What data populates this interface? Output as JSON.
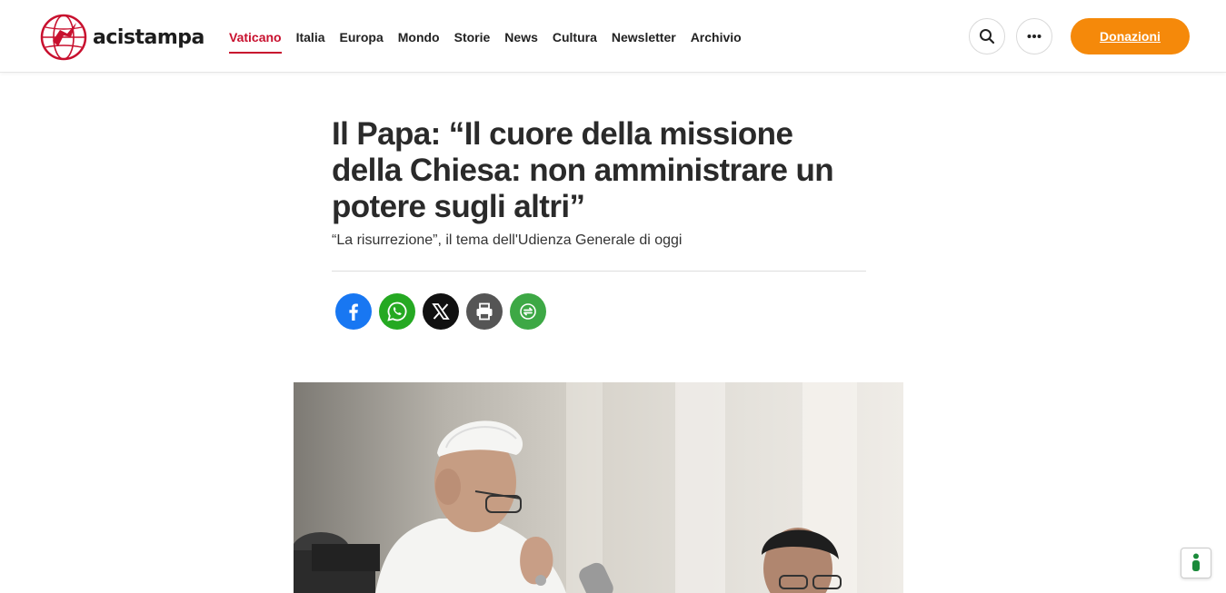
{
  "brand": {
    "name": "acistampa",
    "accent_color": "#c8102e"
  },
  "nav": {
    "items": [
      {
        "label": "Vaticano",
        "active": true
      },
      {
        "label": "Italia",
        "active": false
      },
      {
        "label": "Europa",
        "active": false
      },
      {
        "label": "Mondo",
        "active": false
      },
      {
        "label": "Storie",
        "active": false
      },
      {
        "label": "News",
        "active": false
      },
      {
        "label": "Cultura",
        "active": false
      },
      {
        "label": "Newsletter",
        "active": false
      },
      {
        "label": "Archivio",
        "active": false
      }
    ]
  },
  "header_actions": {
    "search_icon": "search-icon",
    "more_icon": "more-horizontal-icon",
    "donate_label": "Donazioni",
    "donate_color": "#f5890a"
  },
  "article": {
    "headline": "Il Papa: “Il cuore della missione della Chiesa: non amministrare un potere sugli altri”",
    "subtitle": "“La risurrezione”, il tema dell'Udienza Generale di oggi"
  },
  "share": [
    {
      "icon": "facebook-icon",
      "color": "#1877f2"
    },
    {
      "icon": "whatsapp-icon",
      "color": "#25a922"
    },
    {
      "icon": "x-icon",
      "color": "#111111"
    },
    {
      "icon": "print-icon",
      "color": "#555555"
    },
    {
      "icon": "more-share-icon",
      "color": "#3da845"
    }
  ],
  "accessibility_widget": {
    "icon": "accessibility-icon"
  }
}
